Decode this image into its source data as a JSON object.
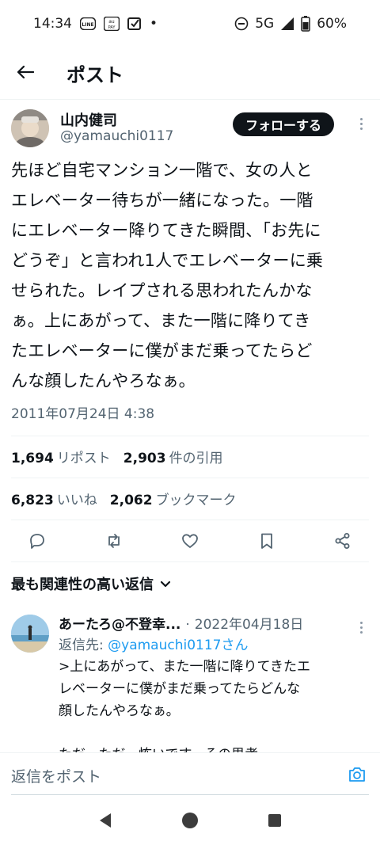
{
  "status_bar": {
    "time": "14:34",
    "app_icons": [
      "line-icon",
      "au-pay-icon",
      "checkbox-icon"
    ],
    "dot": "•",
    "network": "5G",
    "battery": "60%"
  },
  "topbar": {
    "title": "ポスト"
  },
  "post": {
    "author_name": "山内健司",
    "author_handle": "@yamauchi0117",
    "follow_label": "フォローする",
    "lines": [
      "先ほど自宅マンション一階で、女の人と",
      "エレベーター待ちが一緒になった。一階",
      "にエレベーター降りてきた瞬間、「お先に",
      "どうぞ」と言われ1人でエレベーターに乗",
      "せられた。レイプされる思われたんかな",
      "ぁ。上にあがって、また一階に降りてき",
      "たエレベーターに僕がまだ乗ってたらど",
      "んな顔したんやろなぁ。"
    ],
    "timestamp": "2011年07月24日 4:38"
  },
  "stats": {
    "reposts": "1,694",
    "reposts_label": "リポスト",
    "quotes": "2,903",
    "quotes_label": "件の引用",
    "likes": "6,823",
    "likes_label": "いいね",
    "bookmarks": "2,062",
    "bookmarks_label": "ブックマーク"
  },
  "actions": [
    "reply-icon",
    "repost-icon",
    "like-icon",
    "bookmark-icon",
    "share-icon"
  ],
  "replies_header": "最も関連性の高い返信",
  "reply": {
    "name": "あーたろ@不登幸...",
    "date_sep": "·",
    "date": "2022年04月18日",
    "reply_to_prefix": "返信先: ",
    "reply_to_mention": "@yamauchi0117さん",
    "text_lines": [
      ">上にあがって、また一階に降りてきたエ",
      "レベーターに僕がまだ乗ってたらどんな",
      "顔したんやろなぁ。"
    ],
    "cut_line": "ただ、ただ、怖いです、その思考"
  },
  "composer": {
    "placeholder": "返信をポスト"
  },
  "colors": {
    "text": "#0f1419",
    "secondary": "#536471",
    "accent": "#1d9bf0",
    "border": "#eff3f4"
  }
}
